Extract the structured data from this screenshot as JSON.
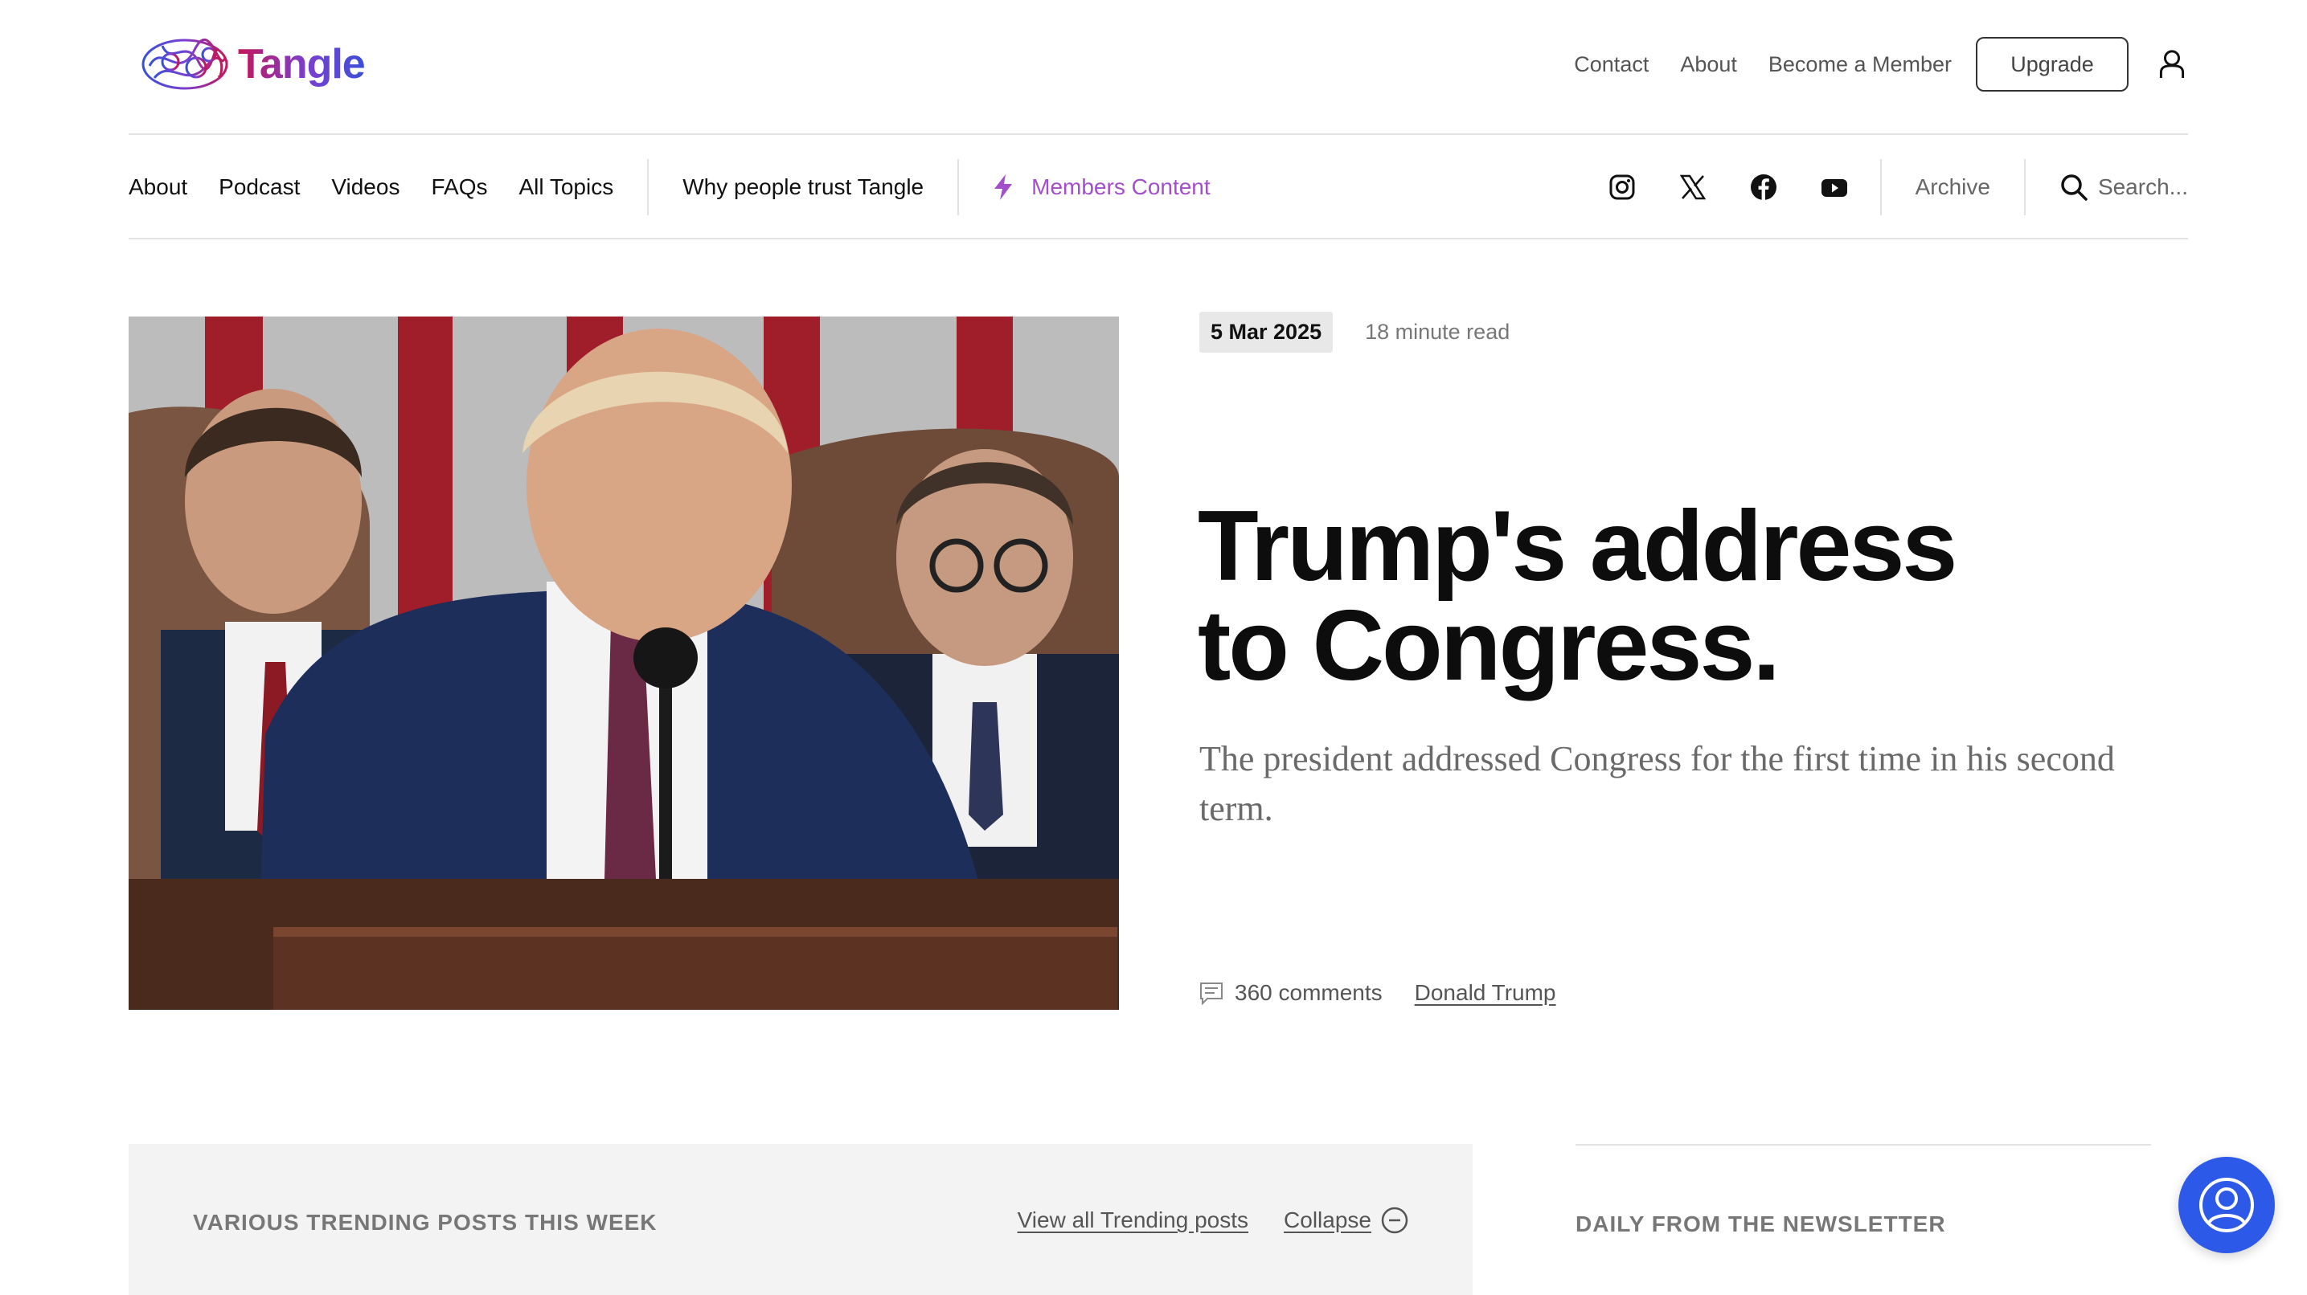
{
  "brand": {
    "name": "Tangle"
  },
  "header": {
    "links": [
      "Contact",
      "About",
      "Become a Member"
    ],
    "upgrade_label": "Upgrade",
    "account_icon": "user-icon"
  },
  "nav": {
    "items": [
      "About",
      "Podcast",
      "Videos",
      "FAQs",
      "All Topics"
    ],
    "trust_label": "Why people trust Tangle",
    "members_label": "Members Content",
    "social_icons": [
      "instagram-icon",
      "x-icon",
      "facebook-icon",
      "youtube-icon"
    ],
    "archive_label": "Archive",
    "search_placeholder": "Search..."
  },
  "article": {
    "date": "5 Mar 2025",
    "read_time": "18 minute read",
    "title_line1": "Trump's address",
    "title_line2": "to Congress.",
    "subtitle": "The president addressed Congress for the first time in his second term.",
    "comments": "360 comments",
    "topic": "Donald Trump"
  },
  "trending": {
    "title": "VARIOUS TRENDING POSTS THIS WEEK",
    "view_all_label": "View all Trending posts",
    "collapse_label": "Collapse"
  },
  "newsletter": {
    "title": "DAILY FROM THE NEWSLETTER"
  },
  "colors": {
    "accent_purple": "#a24fc9",
    "chat_blue": "#2c59e8",
    "logo_gradient": [
      "#c2185b",
      "#7b3fd0",
      "#3a4fd8"
    ]
  }
}
